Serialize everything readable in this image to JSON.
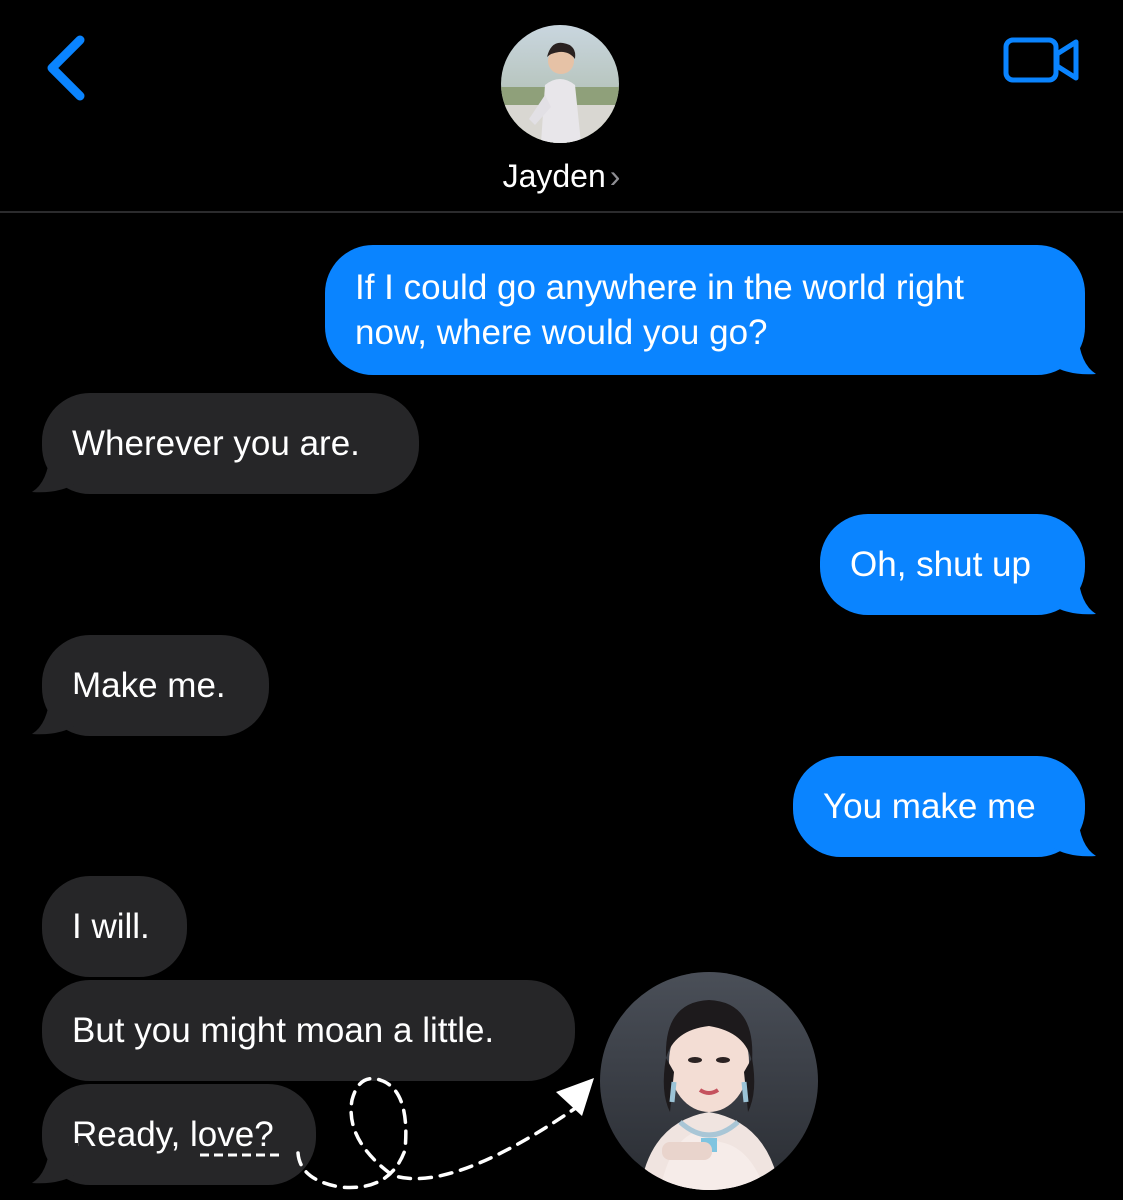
{
  "header": {
    "contact_name": "Jayden",
    "chevron": "›",
    "back_icon": "chevron-left-icon",
    "video_icon": "video-camera-icon",
    "accent": "#0a84ff"
  },
  "messages": [
    {
      "side": "sent",
      "lines": [
        "If I could go anywhere in the world right",
        "now, where would you go?"
      ]
    },
    {
      "side": "received",
      "text": "Wherever you are."
    },
    {
      "side": "sent",
      "text": "Oh, shut up"
    },
    {
      "side": "received",
      "text": "Make me."
    },
    {
      "side": "sent",
      "text": "You make me"
    },
    {
      "side": "received",
      "text": "I will."
    },
    {
      "side": "received",
      "text": "But you might moan a little."
    },
    {
      "side": "received",
      "text_prefix": "Ready, ",
      "text_emph": "love?"
    }
  ],
  "colors": {
    "sent_bubble": "#0a84ff",
    "received_bubble": "#262628",
    "background": "#000000"
  }
}
